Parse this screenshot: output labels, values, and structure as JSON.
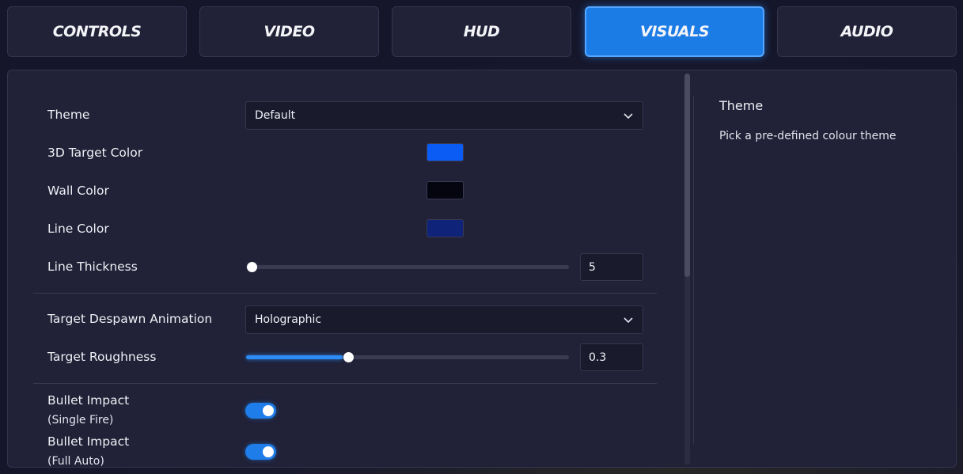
{
  "tabs": [
    {
      "label": "CONTROLS",
      "active": false
    },
    {
      "label": "VIDEO",
      "active": false
    },
    {
      "label": "HUD",
      "active": false
    },
    {
      "label": "VISUALS",
      "active": true
    },
    {
      "label": "AUDIO",
      "active": false
    }
  ],
  "settings": {
    "theme": {
      "label": "Theme",
      "value": "Default"
    },
    "target_color": {
      "label": "3D Target Color",
      "color": "#0a5cf5"
    },
    "wall_color": {
      "label": "Wall Color",
      "color": "#04050f"
    },
    "line_color": {
      "label": "Line Color",
      "color": "#0f2378"
    },
    "line_thickness": {
      "label": "Line Thickness",
      "value": "5",
      "fraction": 0.0
    },
    "despawn": {
      "label": "Target Despawn Animation",
      "value": "Holographic"
    },
    "roughness": {
      "label": "Target Roughness",
      "value": "0.3",
      "fraction": 0.3
    },
    "impact_single": {
      "label": "Bullet Impact",
      "sublabel": "(Single Fire)",
      "enabled": true
    },
    "impact_auto": {
      "label": "Bullet Impact",
      "sublabel": "(Full Auto)",
      "enabled": true
    }
  },
  "help": {
    "title": "Theme",
    "description": "Pick a pre-defined colour theme"
  },
  "icons": {
    "dropdown_arrow": "chevron-down-icon"
  }
}
